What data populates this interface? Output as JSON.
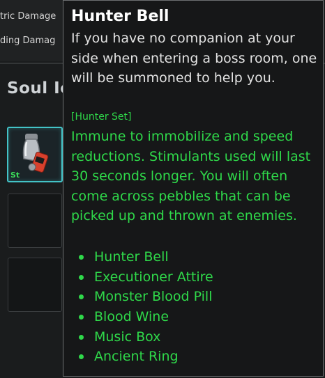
{
  "background": {
    "stats": [
      {
        "label": "tric Damage"
      },
      {
        "label": "ding Damag"
      }
    ],
    "section_title": "Soul Io",
    "slot_badge": "St"
  },
  "tooltip": {
    "title": "Hunter Bell",
    "description": "If you have no companion at your side when entering a boss room, one will be summoned to help you.",
    "set_label": "[Hunter Set]",
    "set_description": "Immune to immobilize and speed reductions. Stimulants used will last 30 seconds longer. You will often come across pebbles that can be picked up and thrown at enemies.",
    "set_items": [
      "Hunter Bell",
      "Executioner Attire",
      "Monster Blood Pill",
      "Blood Wine",
      "Music Box",
      "Ancient Ring"
    ],
    "set_color": "#2fd94a"
  },
  "icons": {
    "equipped_item": "bell-icon"
  }
}
